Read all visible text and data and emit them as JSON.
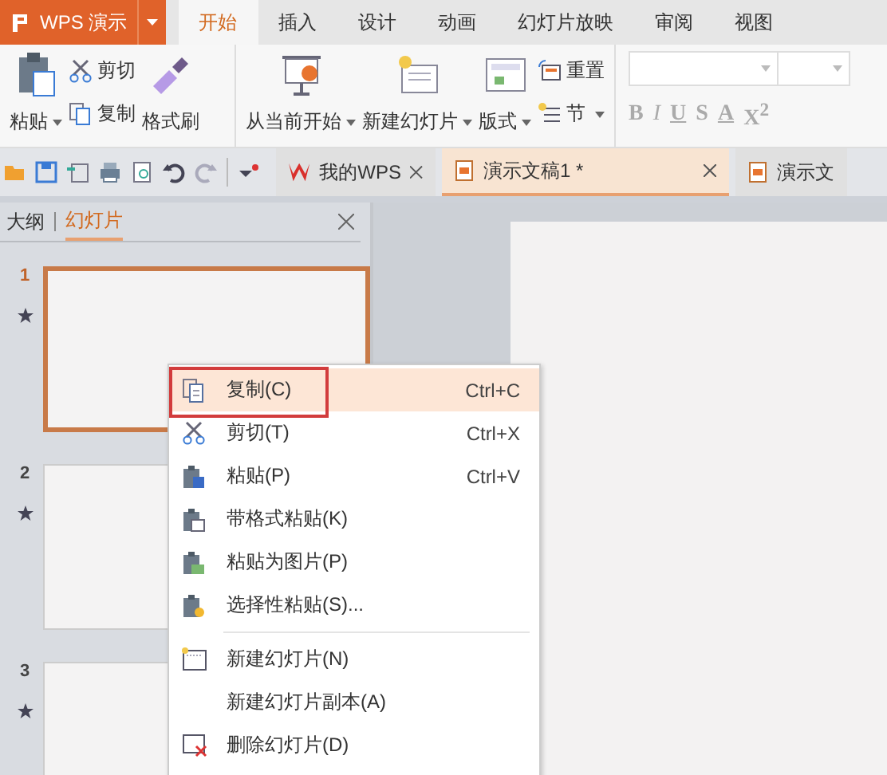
{
  "app_button": {
    "label": "WPS 演示"
  },
  "tabs": [
    {
      "label": "开始",
      "selected": true
    },
    {
      "label": "插入",
      "selected": false
    },
    {
      "label": "设计",
      "selected": false
    },
    {
      "label": "动画",
      "selected": false
    },
    {
      "label": "幻灯片放映",
      "selected": false
    },
    {
      "label": "审阅",
      "selected": false
    },
    {
      "label": "视图",
      "selected": false
    }
  ],
  "clipboard": {
    "paste": "粘贴",
    "cut": "剪切",
    "copy": "复制",
    "format_painter": "格式刷"
  },
  "slides_group": {
    "from_current": "从当前开始",
    "new_slide": "新建幻灯片",
    "layout": "版式",
    "reset": "重置",
    "section": "节"
  },
  "font_buttons": [
    "B",
    "I",
    "U",
    "S",
    "A",
    "X$^{2}$"
  ],
  "doc_tabs": [
    {
      "label": "我的WPS",
      "kind": "home",
      "selected": false
    },
    {
      "label": "演示文稿1 *",
      "kind": "document",
      "selected": true
    },
    {
      "label": "演示文",
      "kind": "document",
      "selected": false
    }
  ],
  "pane_tabs": [
    {
      "label": "大纲",
      "selected": false
    },
    {
      "label": "幻灯片",
      "selected": true
    }
  ],
  "slides": [
    {
      "number": "1",
      "selected": true
    },
    {
      "number": "2",
      "selected": false
    },
    {
      "number": "3",
      "selected": false
    }
  ],
  "context_menu": [
    {
      "label": "复制(C)",
      "shortcut": "Ctrl+C",
      "kind": "copy",
      "selected": true,
      "annotated": true
    },
    {
      "label": "剪切(T)",
      "shortcut": "Ctrl+X",
      "kind": "cut",
      "selected": false,
      "annotated": false
    },
    {
      "label": "粘贴(P)",
      "shortcut": "Ctrl+V",
      "kind": "paste",
      "selected": false,
      "annotated": false
    },
    {
      "label": "带格式粘贴(K)",
      "kind": "paste-format",
      "selected": false,
      "annotated": false
    },
    {
      "label": "粘贴为图片(P)",
      "kind": "paste-picture",
      "selected": false,
      "annotated": false
    },
    {
      "label": "选择性粘贴(S)...",
      "kind": "paste-special",
      "selected": false,
      "annotated": false
    },
    {
      "label": "新建幻灯片(N)",
      "kind": "new-slide",
      "separator_before": true,
      "selected": false,
      "annotated": false
    },
    {
      "label": "新建幻灯片副本(A)",
      "kind": "plain",
      "selected": false,
      "annotated": false
    },
    {
      "label": "删除幻灯片(D)",
      "kind": "delete-slide",
      "selected": false,
      "annotated": false
    }
  ]
}
